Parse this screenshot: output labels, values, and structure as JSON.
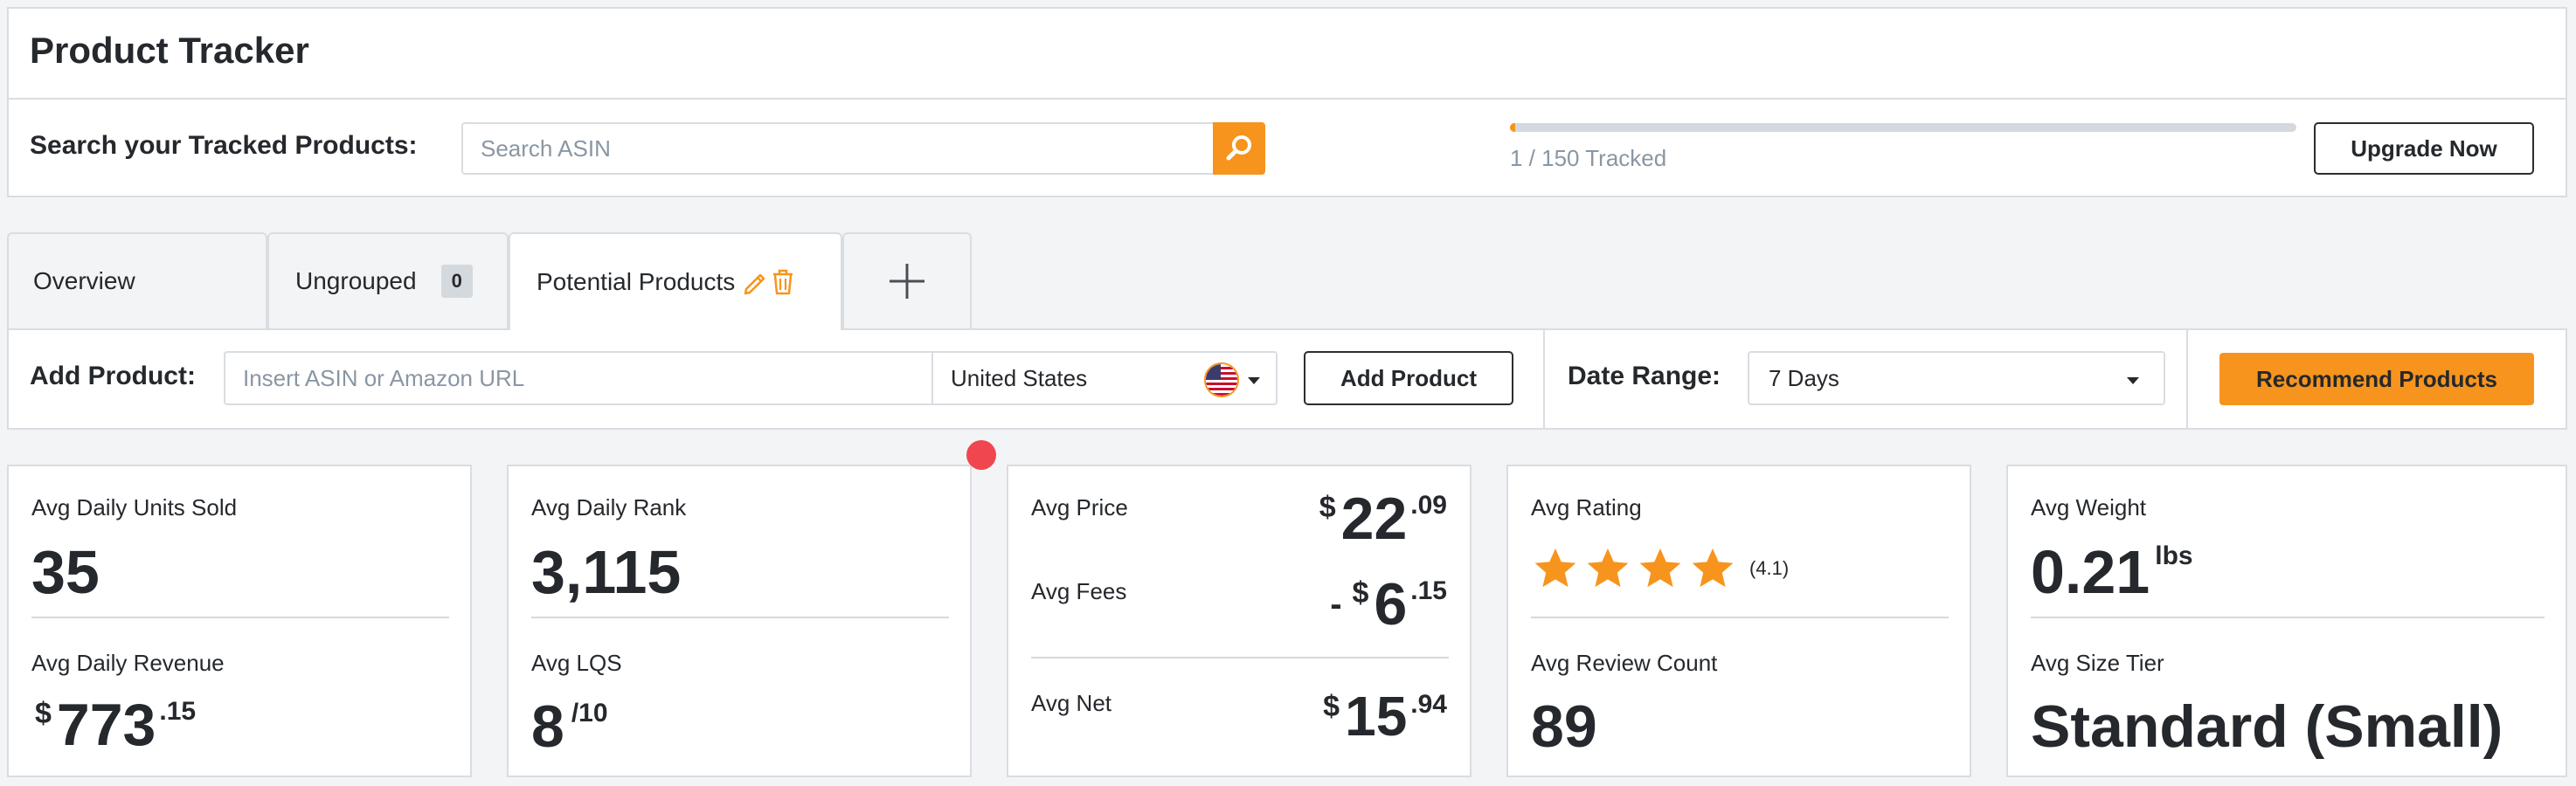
{
  "header": {
    "title": "Product Tracker",
    "search_label": "Search your Tracked Products:",
    "search_placeholder": "Search ASIN",
    "tracked_text": "1 / 150 Tracked",
    "tracked_count": 1,
    "tracked_limit": 150,
    "upgrade_label": "Upgrade Now"
  },
  "tabs": [
    {
      "label": "Overview"
    },
    {
      "label": "Ungrouped",
      "badge": "0"
    },
    {
      "label": "Potential Products"
    }
  ],
  "toolbar": {
    "add_label": "Add Product:",
    "asin_placeholder": "Insert ASIN or Amazon URL",
    "country": "United States",
    "add_button": "Add Product",
    "date_label": "Date Range:",
    "date_value": "7 Days",
    "recommend_button": "Recommend Products"
  },
  "cards": {
    "units": {
      "label": "Avg Daily Units Sold",
      "value": "35",
      "revenue_label": "Avg Daily Revenue",
      "revenue_currency": "$",
      "revenue_whole": "773",
      "revenue_cents": ".15"
    },
    "rank": {
      "label": "Avg Daily Rank",
      "value": "3,115",
      "lqs_label": "Avg LQS",
      "lqs_value": "8",
      "lqs_max": "/10"
    },
    "price": {
      "price_label": "Avg Price",
      "price_currency": "$",
      "price_whole": "22",
      "price_cents": ".09",
      "fees_label": "Avg Fees",
      "fees_sign": "-",
      "fees_currency": "$",
      "fees_whole": "6",
      "fees_cents": ".15",
      "net_label": "Avg Net",
      "net_currency": "$",
      "net_whole": "15",
      "net_cents": ".94"
    },
    "rating": {
      "label": "Avg Rating",
      "stars": 4,
      "value_text": "(4.1)",
      "review_label": "Avg Review Count",
      "review_value": "89"
    },
    "weight": {
      "label": "Avg Weight",
      "value": "0.21",
      "unit": "lbs",
      "size_label": "Avg Size Tier",
      "size_value": "Standard (Small)"
    }
  },
  "colors": {
    "accent": "#f7941d",
    "notification": "#f0464f",
    "border": "#d9dde2",
    "muted_text": "#8a96a3"
  },
  "icons": [
    "search-icon",
    "pencil-icon",
    "trash-icon",
    "plus-icon",
    "us-flag-icon",
    "chevron-down-icon",
    "star-icon"
  ]
}
